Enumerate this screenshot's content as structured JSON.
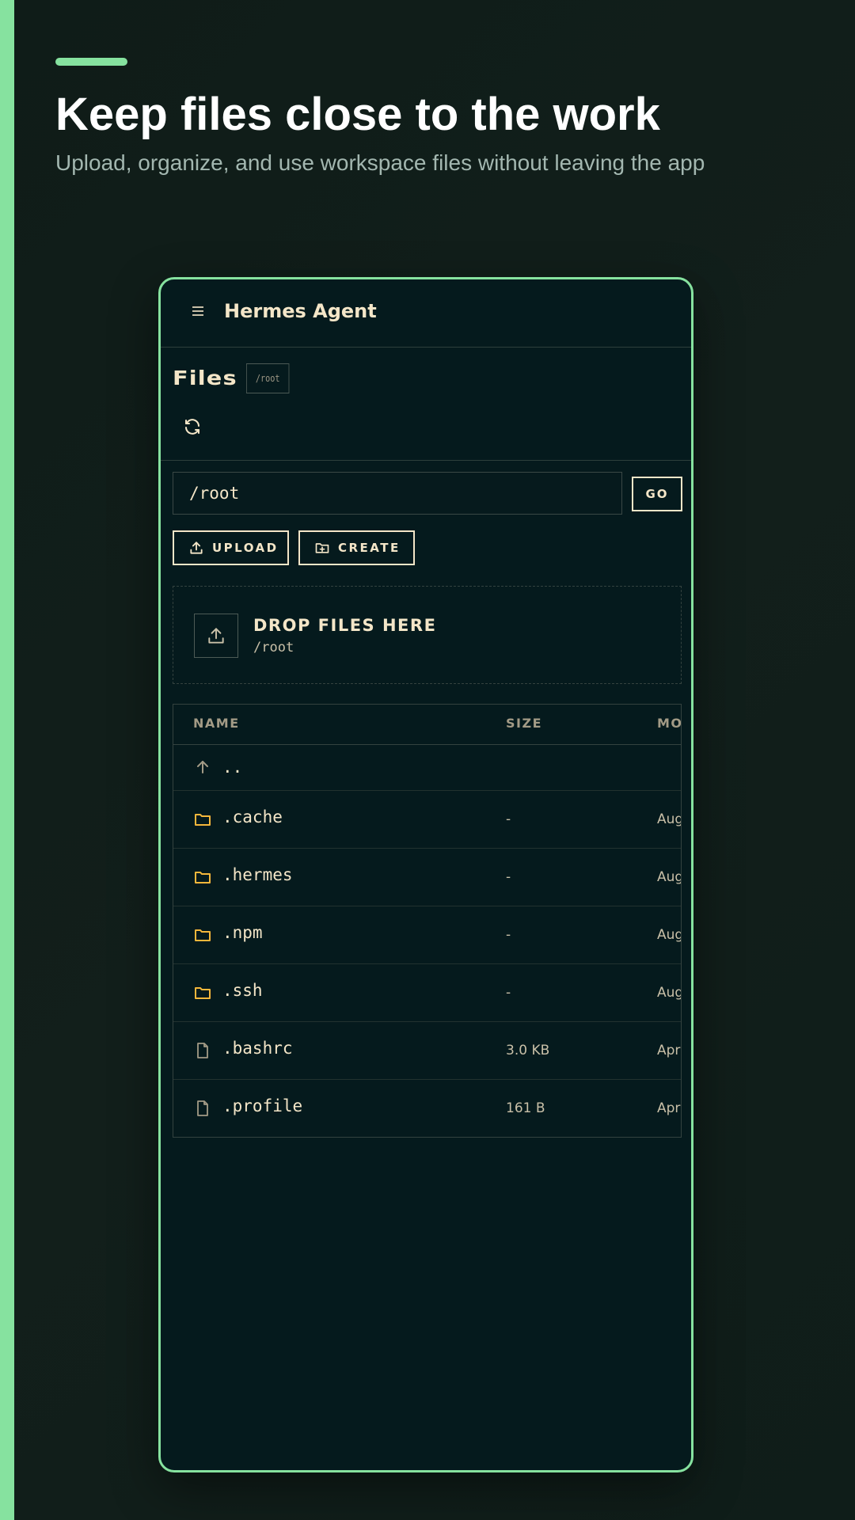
{
  "colors": {
    "accent": "#86e29f",
    "background": "#121f1b",
    "panel": "#051a1d",
    "text_cream": "#f4e6c8",
    "folder": "#f5b73b",
    "muted": "#a39b86"
  },
  "hero": {
    "title": "Keep files close to the work",
    "subtitle": "Upload, organize, and use workspace files without leaving the app"
  },
  "app": {
    "title": "Hermes Agent",
    "menu_icon": "hamburger-menu-icon"
  },
  "files": {
    "title": "Files",
    "path_chip": "/root",
    "refresh_icon": "refresh-icon"
  },
  "path_bar": {
    "value": "/root",
    "go_label": "GO"
  },
  "actions": {
    "upload_label": "UPLOAD",
    "create_label": "CREATE"
  },
  "dropzone": {
    "title": "DROP FILES HERE",
    "path": "/root"
  },
  "table": {
    "columns": [
      "NAME",
      "SIZE",
      "MO"
    ],
    "parent_label": "..",
    "rows": [
      {
        "type": "folder",
        "name": ".cache",
        "size": "-",
        "modified": "Aug"
      },
      {
        "type": "folder",
        "name": ".hermes",
        "size": "-",
        "modified": "Aug"
      },
      {
        "type": "folder",
        "name": ".npm",
        "size": "-",
        "modified": "Aug"
      },
      {
        "type": "folder",
        "name": ".ssh",
        "size": "-",
        "modified": "Aug"
      },
      {
        "type": "file",
        "name": ".bashrc",
        "size": "3.0 KB",
        "modified": "Apr"
      },
      {
        "type": "file",
        "name": ".profile",
        "size": "161 B",
        "modified": "Apr"
      }
    ]
  }
}
